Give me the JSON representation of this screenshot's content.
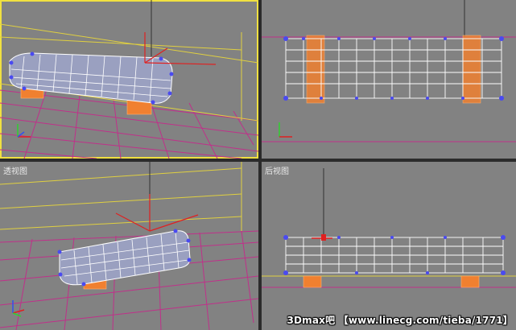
{
  "viewports": {
    "top_left": {
      "label": ""
    },
    "top_right": {
      "label": ""
    },
    "bottom_left": {
      "label": "透视图"
    },
    "bottom_right": {
      "label": "后视图"
    }
  },
  "watermark": "3Dmax吧 【www.linecg.com/tieba/1771】",
  "colors": {
    "viewport_bg": "#828282",
    "active_border": "#f0e040",
    "grid": "#c0308a",
    "horizon": "#e0d040",
    "mesh_wire": "#ffffff",
    "mesh_vertex": "#4a4af0",
    "support": "#f08030",
    "gizmo": "#e02020"
  },
  "icons": [
    "axis-tripod-icon",
    "transform-gizmo-icon"
  ]
}
